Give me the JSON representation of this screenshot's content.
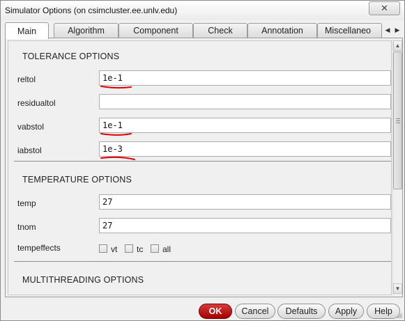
{
  "window": {
    "title": "Simulator Options (on csimcluster.ee.unlv.edu)",
    "close_icon": "close-icon"
  },
  "tabs": [
    {
      "label": "Main",
      "active": true
    },
    {
      "label": "Algorithm"
    },
    {
      "label": "Component"
    },
    {
      "label": "Check"
    },
    {
      "label": "Annotation"
    },
    {
      "label": "Miscellaneo"
    }
  ],
  "tab_scroll": {
    "left": "◀",
    "right": "▶"
  },
  "tolerance": {
    "title": "TOLERANCE OPTIONS",
    "reltol": {
      "label": "reltol",
      "value": "1e-1"
    },
    "residualtol": {
      "label": "residualtol",
      "value": ""
    },
    "vabstol": {
      "label": "vabstol",
      "value": "1e-1"
    },
    "iabstol": {
      "label": "iabstol",
      "value": "1e-3"
    }
  },
  "temperature": {
    "title": "TEMPERATURE OPTIONS",
    "temp": {
      "label": "temp",
      "value": "27"
    },
    "tnom": {
      "label": "tnom",
      "value": "27"
    },
    "tempeffects": {
      "label": "tempeffects",
      "options": [
        {
          "label": "vt",
          "checked": false
        },
        {
          "label": "tc",
          "checked": false
        },
        {
          "label": "all",
          "checked": false
        }
      ]
    }
  },
  "multithreading": {
    "title": "MULTITHREADING OPTIONS"
  },
  "scrollbar": {
    "up": "▲",
    "down": "▼"
  },
  "buttons": {
    "ok": "OK",
    "cancel": "Cancel",
    "defaults": "Defaults",
    "apply": "Apply",
    "help": "Help"
  },
  "colors": {
    "ok_button": "#b80000",
    "annotation_underline": "#e00000"
  }
}
